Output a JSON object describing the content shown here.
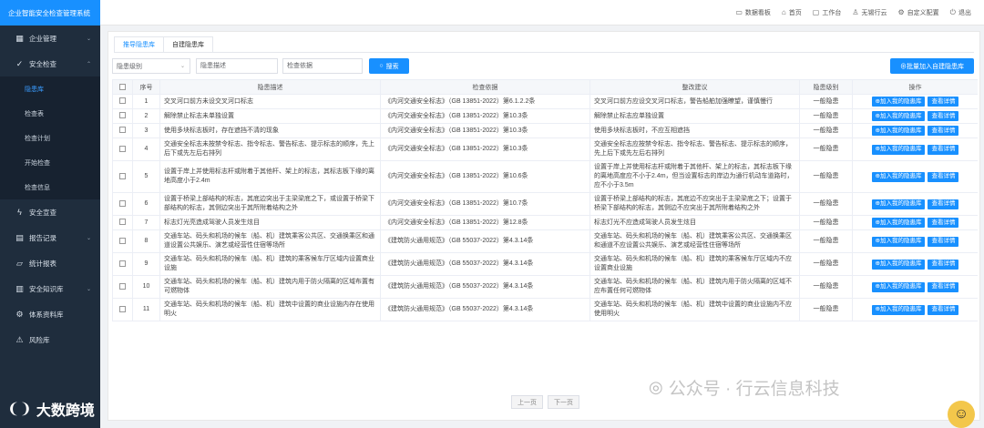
{
  "app": {
    "title": "企业智能安全检查管理系统"
  },
  "header": {
    "items": [
      {
        "icon": "monitor-icon",
        "label": "数据看板"
      },
      {
        "icon": "home-icon",
        "label": "首页"
      },
      {
        "icon": "desktop-icon",
        "label": "工作台"
      },
      {
        "icon": "user-icon",
        "label": "无锡行云"
      },
      {
        "icon": "gear-icon",
        "label": "自定义配置"
      },
      {
        "icon": "power-icon",
        "label": "退出"
      }
    ]
  },
  "sidebar": {
    "items": [
      {
        "label": "企业管理",
        "icon": "building-icon",
        "chevron": "⌄"
      },
      {
        "label": "安全检查",
        "icon": "check-icon",
        "chevron": "⌃"
      }
    ],
    "sub_items": [
      "隐患库",
      "检查表",
      "检查计划",
      "开始检查",
      "检查信息"
    ],
    "items_after": [
      {
        "label": "安全宣查",
        "icon": "bolt-icon"
      },
      {
        "label": "报告记录",
        "icon": "report-icon",
        "chevron": "⌄"
      },
      {
        "label": "统计报表",
        "icon": "folder-icon"
      },
      {
        "label": "安全知识库",
        "icon": "book-icon",
        "chevron": "⌄"
      },
      {
        "label": "体系资料库",
        "icon": "gear-icon"
      },
      {
        "label": "风险库",
        "icon": "warning-icon"
      }
    ]
  },
  "tabs": [
    "推导隐患库",
    "自建隐患库"
  ],
  "filters": {
    "level_placeholder": "隐患级别",
    "desc_placeholder": "隐患描述",
    "basis_placeholder": "检查依据",
    "search_label": "搜索",
    "batch_label": "⊕批量加入自建隐患库"
  },
  "table": {
    "headers": [
      "序号",
      "隐患描述",
      "检查依据",
      "整改建议",
      "隐患级别",
      "操作"
    ],
    "op_add": "⊕加入我的隐患库",
    "op_detail": "查看详情",
    "rows": [
      {
        "no": "1",
        "desc": "交叉河口前方未设交叉河口标志",
        "basis": "《内河交通安全标志》（GB 13851-2022）第6.1.2.2条",
        "advice": "交叉河口前方应设交叉河口标志，警告船舶加强瞭望，谨慎慢行",
        "level": "一般隐患"
      },
      {
        "no": "2",
        "desc": "解除禁止标志未单独设置",
        "basis": "《内河交通安全标志》（GB 13851-2022）第10.3条",
        "advice": "解除禁止标志应单独设置",
        "level": "一般隐患"
      },
      {
        "no": "3",
        "desc": "使用多块标志板时，存在遮挡不清的现象",
        "basis": "《内河交通安全标志》（GB 13851-2022）第10.3条",
        "advice": "使用多块标志板时，不应互相遮挡",
        "level": "一般隐患"
      },
      {
        "no": "4",
        "desc": "交通安全标志未按禁令标志、指令标志、警告标志、提示标志的顺序，先上后下或先左后右排列",
        "basis": "《内河交通安全标志》（GB 13851-2022）第10.3条",
        "advice": "交通安全标志应按禁令标志、指令标志、警告标志、提示标志的顺序，先上后下或先左后右排列",
        "level": "一般隐患"
      },
      {
        "no": "5",
        "desc": "设置于岸上并使用标志杆或附着于其他杆、架上的标志，其标志板下缘的离地高度小于2.4m",
        "basis": "《内河交通安全标志》（GB 13851-2022）第10.6条",
        "advice": "设置于岸上并使用标志杆或附着于其他杆、架上的标志，其标志板下缘的离地高度应不小于2.4m，但当设置标志的岸边为通行机动车道路时，应不小于3.5m",
        "level": "一般隐患"
      },
      {
        "no": "6",
        "desc": "设置于桥梁上部结构的标志，其底边突出于主梁梁底之下，或设置于桥梁下部结构的标志，其侧边突出于其所附着结构之外",
        "basis": "《内河交通安全标志》（GB 13851-2022）第10.7条",
        "advice": "设置于桥梁上部结构的标志，其底边不应突出于主梁梁底之下；设置于桥梁下部结构的标志，其侧边不应突出于其所附着结构之外",
        "level": "一般隐患"
      },
      {
        "no": "7",
        "desc": "标志灯光亮造成驾驶人员发生炫目",
        "basis": "《内河交通安全标志》（GB 13851-2022）第12.8条",
        "advice": "标志灯光不应造成驾驶人员发生炫目",
        "level": "一般隐患"
      },
      {
        "no": "8",
        "desc": "交通车站、码头和机场的候车（船、机）建筑乘客公共区、交通换乘区和通道设置公共娱乐、演艺或经营性住宿等场所",
        "basis": "《建筑防火通用规范》（GB 55037-2022）第4.3.14条",
        "advice": "交通车站、码头和机场的候车（船、机）建筑乘客公共区、交通换乘区和通道不应设置公共娱乐、演艺或经营性住宿等场所",
        "level": "一般隐患"
      },
      {
        "no": "9",
        "desc": "交通车站、码头和机场的候车（船、机）建筑的乘客候车厅区域内设置商业设施",
        "basis": "《建筑防火通用规范》（GB 55037-2022）第4.3.14条",
        "advice": "交通车站、码头和机场的候车（船、机）建筑的乘客候车厅区域内不应设置商业设施",
        "level": "一般隐患"
      },
      {
        "no": "10",
        "desc": "交通车站、码头和机场的候车（船、机）建筑内用于防火隔离的区域布置有可燃物体",
        "basis": "《建筑防火通用规范》（GB 55037-2022）第4.3.14条",
        "advice": "交通车站、码头和机场的候车（船、机）建筑内用于防火隔离的区域不应布置任何可燃物体",
        "level": "一般隐患"
      },
      {
        "no": "11",
        "desc": "交通车站、码头和机场的候车（船、机）建筑中设置的商业设施内存在使用明火",
        "basis": "《建筑防火通用规范》（GB 55037-2022）第4.3.14条",
        "advice": "交通车站、码头和机场的候车（船、机）建筑中设置的商业设施内不应使用明火",
        "level": "一般隐患"
      }
    ]
  },
  "pager": {
    "prev": "上一页",
    "next": "下一页"
  },
  "watermarks": {
    "left": "大数跨境",
    "right": "公众号 · 行云信息科技"
  }
}
